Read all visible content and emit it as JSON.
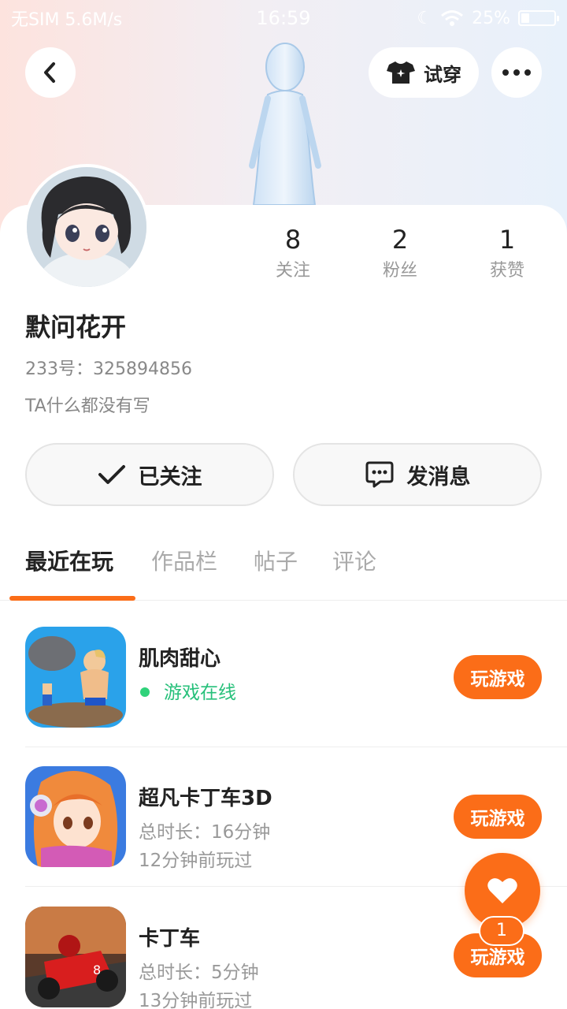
{
  "status_bar": {
    "carrier": "无SIM 5.6M/s",
    "time": "16:59",
    "battery": "25%"
  },
  "header": {
    "try_on_label": "试穿"
  },
  "stats": [
    {
      "value": "8",
      "label": "关注"
    },
    {
      "value": "2",
      "label": "粉丝"
    },
    {
      "value": "1",
      "label": "获赞"
    }
  ],
  "profile": {
    "name": "默问花开",
    "uid": "233号：325894856",
    "bio": "TA什么都没有写"
  },
  "actions": {
    "follow_label": "已关注",
    "message_label": "发消息"
  },
  "tabs": [
    "最近在玩",
    "作品栏",
    "帖子",
    "评论"
  ],
  "games": [
    {
      "title": "肌肉甜心",
      "status": "游戏在线",
      "play_label": "玩游戏"
    },
    {
      "title": "超凡卡丁车3D",
      "duration": "总时长：16分钟",
      "last_played": "12分钟前玩过",
      "play_label": "玩游戏"
    },
    {
      "title": "卡丁车",
      "duration": "总时长：5分钟",
      "last_played": "13分钟前玩过",
      "play_label": "玩游戏"
    }
  ],
  "fab": {
    "count": "1"
  },
  "colors": {
    "accent": "#fb6d18",
    "online": "#26c07a"
  }
}
